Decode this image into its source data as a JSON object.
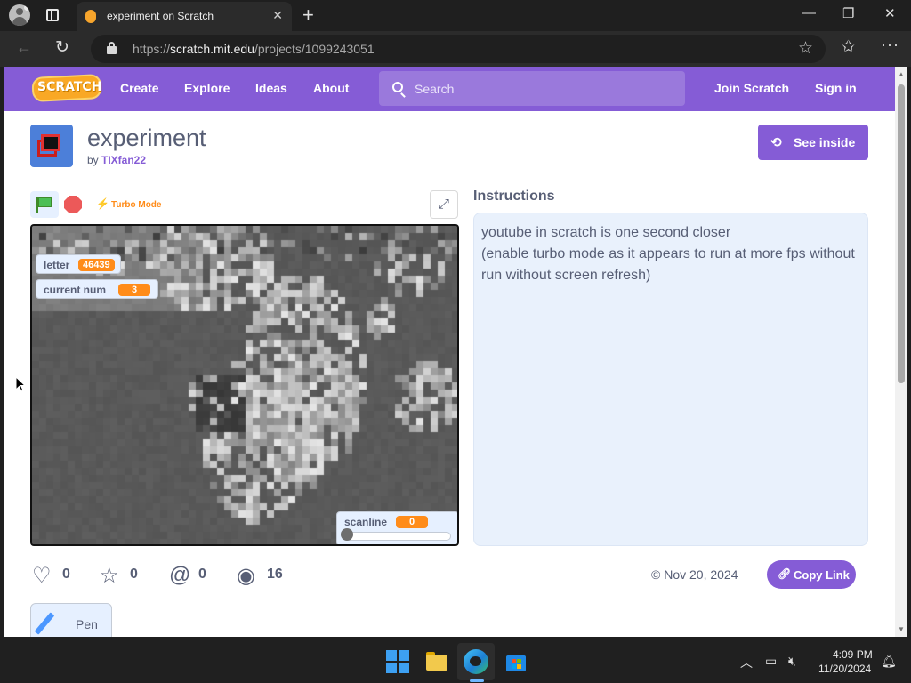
{
  "browser": {
    "tab_title": "experiment on Scratch",
    "url_scheme": "https://",
    "url_host": "scratch.mit.edu",
    "url_path": "/projects/1099243051"
  },
  "menubar": {
    "logo_text": "SCRATCH",
    "items": [
      "Create",
      "Explore",
      "Ideas",
      "About"
    ],
    "search_placeholder": "Search",
    "join": "Join Scratch",
    "signin": "Sign in"
  },
  "project": {
    "title": "experiment",
    "by_prefix": "by ",
    "author": "TIXfan22",
    "see_inside": "See inside",
    "turbo_label": "Turbo Mode",
    "instructions_heading": "Instructions",
    "instructions_lines": [
      "youtube in scratch is one second closer",
      "(enable turbo mode as it appears to run at more fps without run without screen refresh)"
    ]
  },
  "monitors": {
    "letter": {
      "label": "letter",
      "value": "46439"
    },
    "current_num": {
      "label": "current num",
      "value": "3"
    },
    "scanline": {
      "label": "scanline",
      "value": "0",
      "slider_fraction": 0.0
    }
  },
  "stats": {
    "loves": "0",
    "favorites": "0",
    "remixes": "0",
    "views": "16",
    "date": "Nov 20, 2024",
    "copy_link": "Copy Link"
  },
  "tags": {
    "pen": "Pen"
  },
  "taskbar": {
    "time": "4:09 PM",
    "date": "11/20/2024"
  },
  "colors": {
    "scratch_purple": "#855cd6",
    "turbo_orange": "#ff8c1a",
    "monitor_value": "#ff8c1a"
  }
}
